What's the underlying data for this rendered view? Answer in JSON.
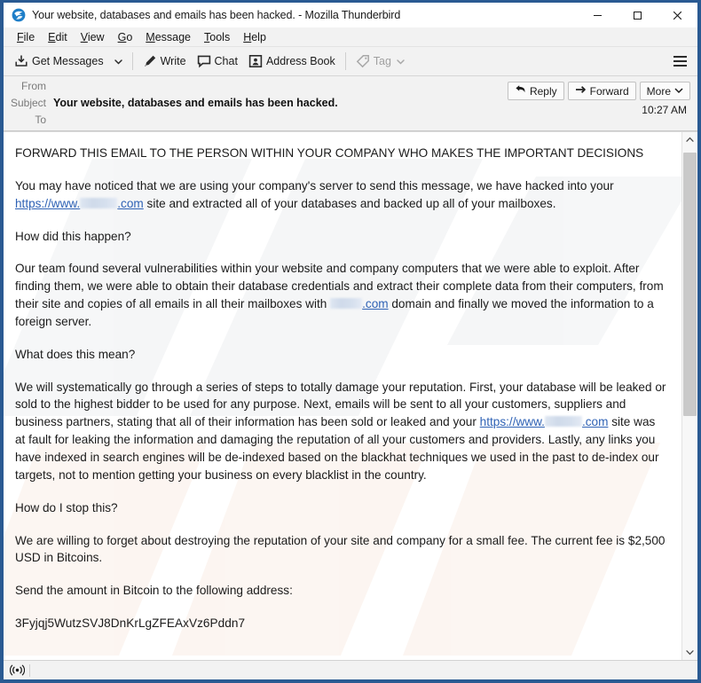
{
  "window": {
    "title": "Your website, databases and emails has been hacked. - Mozilla Thunderbird",
    "app_icon": "thunderbird-icon",
    "controls": {
      "minimize": "minimize-icon",
      "maximize": "maximize-icon",
      "close": "close-icon"
    },
    "frame_color": "#2a5a92"
  },
  "menubar": {
    "items": [
      {
        "label": "File",
        "accesskey": "F"
      },
      {
        "label": "Edit",
        "accesskey": "E"
      },
      {
        "label": "View",
        "accesskey": "V"
      },
      {
        "label": "Go",
        "accesskey": "G"
      },
      {
        "label": "Message",
        "accesskey": "M"
      },
      {
        "label": "Tools",
        "accesskey": "T"
      },
      {
        "label": "Help",
        "accesskey": "H"
      }
    ]
  },
  "toolbar": {
    "get_messages": "Get Messages",
    "get_messages_icon": "download-inbox-icon",
    "get_messages_dropdown_icon": "chevron-down-icon",
    "write": "Write",
    "write_icon": "pencil-icon",
    "chat": "Chat",
    "chat_icon": "speech-bubble-icon",
    "address_book": "Address Book",
    "address_book_icon": "contact-card-icon",
    "tag": "Tag",
    "tag_icon": "tag-icon",
    "tag_dropdown_icon": "chevron-down-icon",
    "tag_disabled": true,
    "app_menu_icon": "hamburger-menu-icon"
  },
  "message_header": {
    "from_label": "From",
    "from_value": "",
    "subject_label": "Subject",
    "subject_value": "Your website, databases and emails has been hacked.",
    "to_label": "To",
    "to_value": "",
    "timestamp": "10:27 AM",
    "actions": [
      {
        "label": "Reply",
        "icon": "reply-arrow-icon"
      },
      {
        "label": "Forward",
        "icon": "forward-arrow-icon"
      },
      {
        "label": "More",
        "icon": "chevron-down-icon"
      }
    ]
  },
  "message_body": {
    "p1": "FORWARD THIS EMAIL TO THE PERSON WITHIN YOUR COMPANY WHO MAKES THE IMPORTANT DECISIONS",
    "p2_a": "You may have noticed that we are using your company's server to send this message, we have hacked into your ",
    "p2_link_pre": "https://www.",
    "p2_link_post": ".com",
    "p2_b": " site and extracted all of your databases and backed up all of your mailboxes.",
    "p3": "How did this happen?",
    "p4_a": "Our team found several vulnerabilities within your website and company computers that we were able to exploit. After finding them, we were able to obtain their database credentials and extract their complete data from their computers, from their site and copies of all emails in all their mailboxes with ",
    "p4_link_post": ".com",
    "p4_b": " domain and finally we moved the information to a foreign server.",
    "p5": "What does this mean?",
    "p6_a": "We will systematically go through a series of steps to totally damage your reputation. First, your database will be leaked or sold to the highest bidder to be used for any purpose. Next, emails will be sent to all your customers, suppliers and business partners, stating that all of their information has been sold or leaked and your ",
    "p6_link_pre": "https://www.",
    "p6_link_post": ".com",
    "p6_b": " site was at fault for leaking the information and damaging the reputation of all your customers and providers. Lastly, any links you have indexed in search engines will be de-indexed based on the blackhat techniques we used in the past to de-index our targets, not to mention getting your business on every blacklist in the country.",
    "p7": "How do I stop this?",
    "p8": "We are willing to forget about destroying the reputation of your site and company for a small fee. The current fee is $2,500 USD in Bitcoins.",
    "p9": "Send the amount in Bitcoin to the following address:",
    "bitcoin_address": "3Fyjqj5WutzSVJ8DnKrLgZFEAxVz6Pddn7",
    "link_color": "#2f62b5"
  },
  "scrollbar": {
    "up_icon": "chevron-up-icon",
    "down_icon": "chevron-down-icon",
    "thumb_top_pct": 1,
    "thumb_height_pct": 53
  },
  "statusbar": {
    "online_icon": "broadcast-online-icon"
  }
}
